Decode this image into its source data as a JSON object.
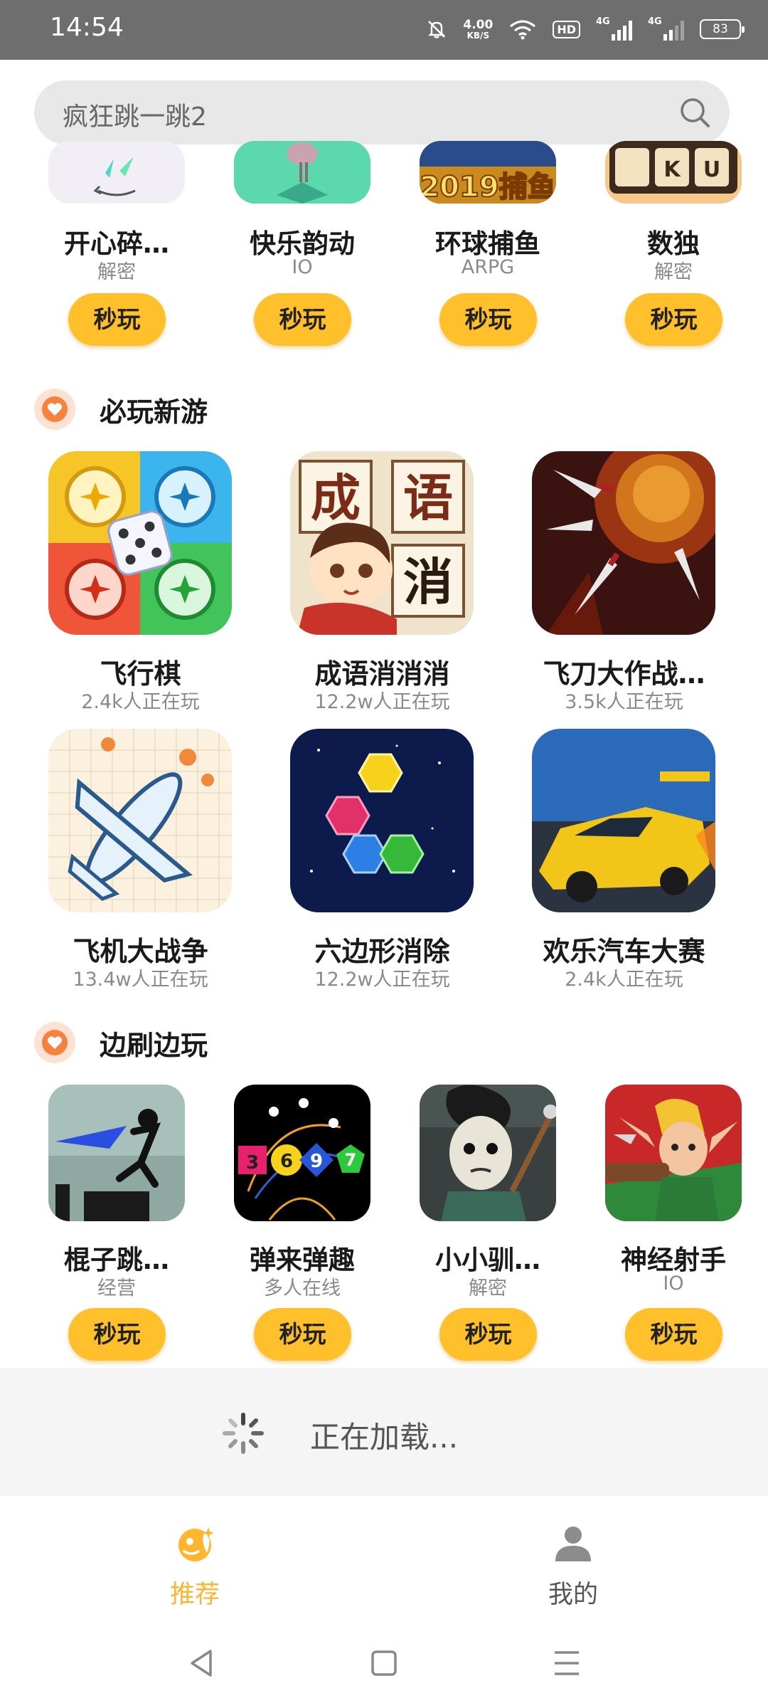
{
  "status_bar": {
    "time": "14:54",
    "net_speed": "4.00",
    "net_unit": "KB/S",
    "hd": "HD",
    "net_type_1": "4G",
    "net_type_2": "4G",
    "battery": "83"
  },
  "search": {
    "value": "疯狂跳一跳2"
  },
  "top_row": [
    {
      "name": "开心碎…",
      "genre": "解密",
      "button": "秒玩"
    },
    {
      "name": "快乐韵动",
      "genre": "IO",
      "button": "秒玩"
    },
    {
      "name": "环球捕鱼",
      "genre": "ARPG",
      "button": "秒玩"
    },
    {
      "name": "数独",
      "genre": "解密",
      "button": "秒玩"
    }
  ],
  "top_row_art": {
    "fish_year_text": "2019捕鱼",
    "sudoku_letters": [
      "K",
      "U"
    ]
  },
  "section_new": {
    "title": "必玩新游",
    "games": [
      {
        "name": "飞行棋",
        "players": "2.4k人正在玩"
      },
      {
        "name": "成语消消消",
        "players": "12.2w人正在玩"
      },
      {
        "name": "飞刀大作战…",
        "players": "3.5k人正在玩"
      },
      {
        "name": "飞机大战争",
        "players": "13.4w人正在玩"
      },
      {
        "name": "六边形消除",
        "players": "12.2w人正在玩"
      },
      {
        "name": "欢乐汽车大赛",
        "players": "2.4k人正在玩"
      }
    ],
    "idiom_art_chars": [
      "成",
      "语",
      "消"
    ]
  },
  "section_play": {
    "title": "边刷边玩",
    "games": [
      {
        "name": "棍子跳…",
        "genre": "经营",
        "button": "秒玩"
      },
      {
        "name": "弹来弹趣",
        "genre": "多人在线",
        "button": "秒玩"
      },
      {
        "name": "小小驯…",
        "genre": "解密",
        "button": "秒玩"
      },
      {
        "name": "神经射手",
        "genre": "IO",
        "button": "秒玩"
      }
    ],
    "bounce_art_numbers": [
      "3",
      "6",
      "9",
      "7"
    ]
  },
  "loading": {
    "text": "正在加载..."
  },
  "bottom_nav": {
    "tabs": [
      {
        "label": "推荐",
        "active": true
      },
      {
        "label": "我的",
        "active": false
      }
    ],
    "accent": "#ffb52e"
  },
  "colors": {
    "button": "#ffc02b",
    "section_badge": "#f7813e"
  }
}
